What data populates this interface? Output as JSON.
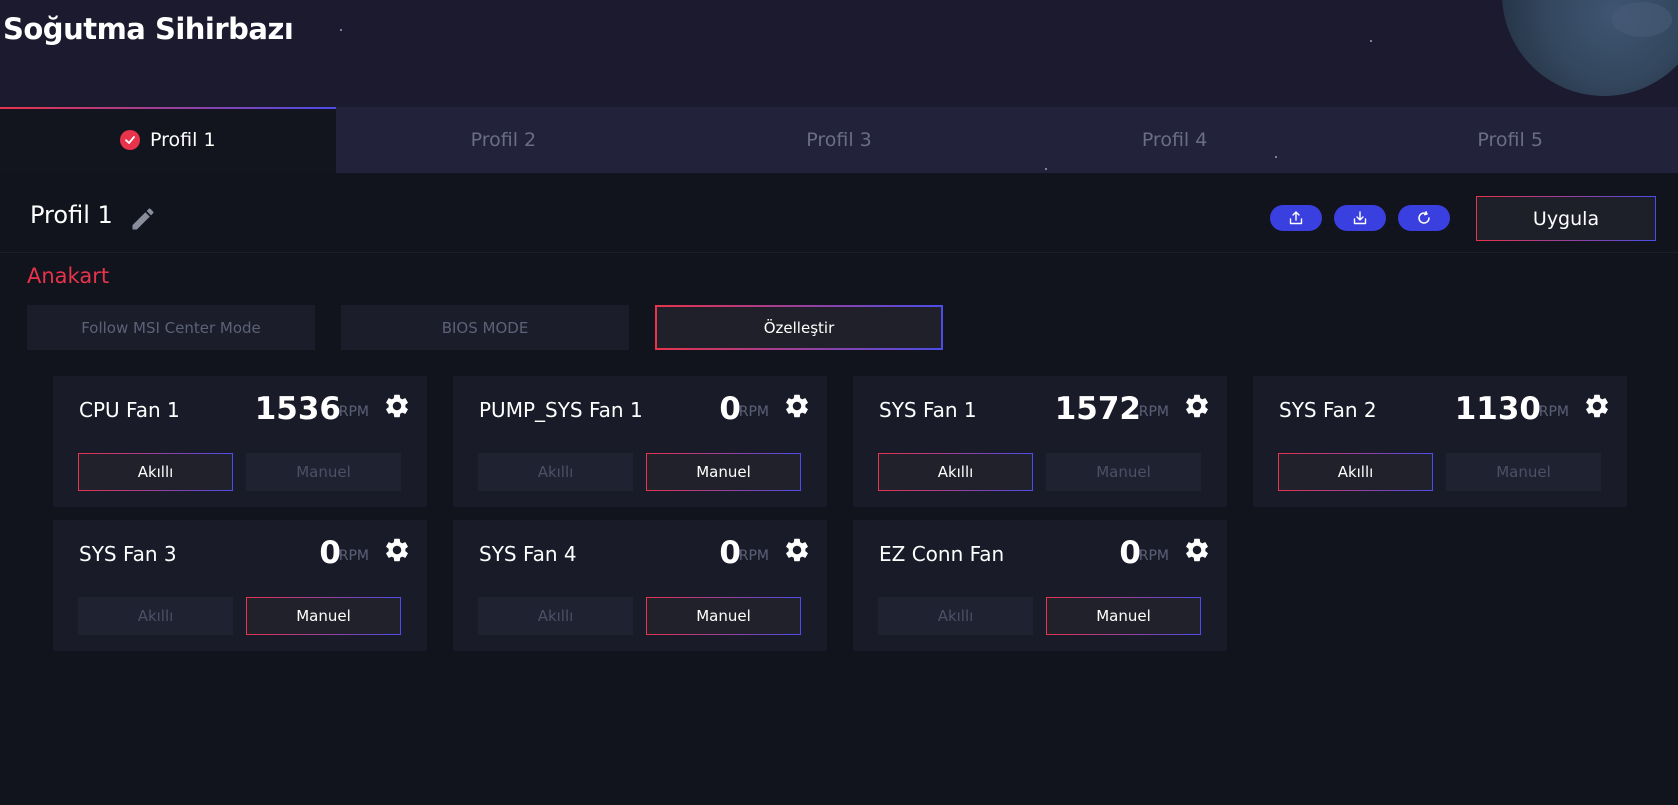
{
  "app": {
    "title": "Soğutma Sihirbazı"
  },
  "tabs": [
    {
      "label": "Profil 1",
      "active": true
    },
    {
      "label": "Profil 2",
      "active": false
    },
    {
      "label": "Profil 3",
      "active": false
    },
    {
      "label": "Profil 4",
      "active": false
    },
    {
      "label": "Profil 5",
      "active": false
    }
  ],
  "profile": {
    "name": "Profil 1",
    "icons": [
      "export-icon",
      "import-icon",
      "reset-icon"
    ],
    "apply_label": "Uygula"
  },
  "section": {
    "title": "Anakart",
    "modes": [
      {
        "label": "Follow MSI Center Mode",
        "active": false
      },
      {
        "label": "BIOS MODE",
        "active": false
      },
      {
        "label": "Özelleştir",
        "active": true
      }
    ]
  },
  "fans": [
    {
      "name": "CPU Fan 1",
      "rpm": "1536",
      "unit": "RPM",
      "smart_label": "Akıllı",
      "manual_label": "Manuel",
      "mode": "smart"
    },
    {
      "name": "PUMP_SYS Fan 1",
      "rpm": "0",
      "unit": "RPM",
      "smart_label": "Akıllı",
      "manual_label": "Manuel",
      "mode": "manual"
    },
    {
      "name": "SYS Fan 1",
      "rpm": "1572",
      "unit": "RPM",
      "smart_label": "Akıllı",
      "manual_label": "Manuel",
      "mode": "smart"
    },
    {
      "name": "SYS Fan 2",
      "rpm": "1130",
      "unit": "RPM",
      "smart_label": "Akıllı",
      "manual_label": "Manuel",
      "mode": "smart"
    },
    {
      "name": "SYS Fan 3",
      "rpm": "0",
      "unit": "RPM",
      "smart_label": "Akıllı",
      "manual_label": "Manuel",
      "mode": "manual"
    },
    {
      "name": "SYS Fan 4",
      "rpm": "0",
      "unit": "RPM",
      "smart_label": "Akıllı",
      "manual_label": "Manuel",
      "mode": "manual"
    },
    {
      "name": "EZ Conn Fan",
      "rpm": "0",
      "unit": "RPM",
      "smart_label": "Akıllı",
      "manual_label": "Manuel",
      "mode": "manual"
    }
  ],
  "colors": {
    "accent_red": "#e8334b",
    "accent_blue": "#4b4de8",
    "icon_button": "#3a3fe0",
    "background": "#12141d"
  }
}
